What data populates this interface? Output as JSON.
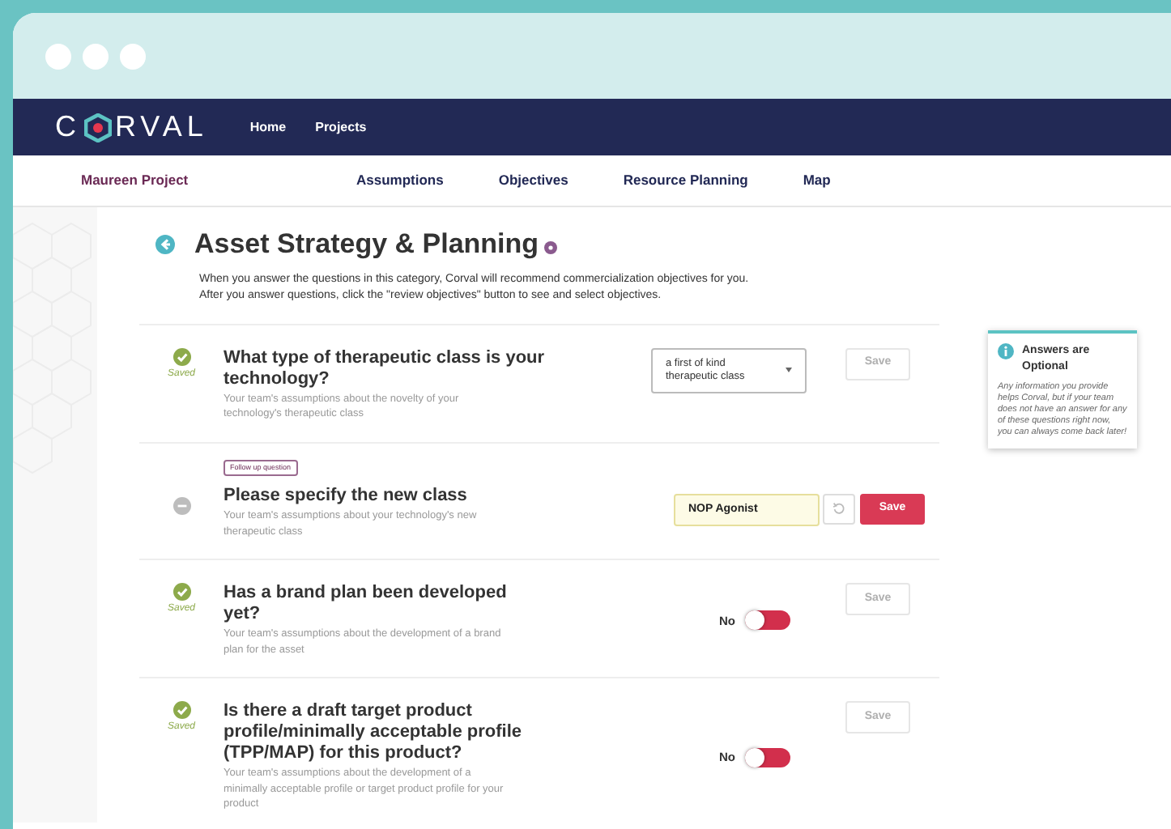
{
  "brand": {
    "first": "C",
    "rest": "RVAL"
  },
  "nav": [
    {
      "label": "Home"
    },
    {
      "label": "Projects"
    }
  ],
  "project": "Maureen Project",
  "tabs": [
    {
      "label": "Assumptions",
      "selected": false
    },
    {
      "label": "Objectives",
      "selected": false
    },
    {
      "label": "Resource Planning",
      "selected": false
    },
    {
      "label": "Map",
      "selected": false
    }
  ],
  "title": "Asset Strategy & Planning",
  "intro": [
    "When you answer the questions in this category, Corval will recommend commercialization objectives for you.",
    "After you answer questions, click the \"review objectives\" button to see and select objectives."
  ],
  "questions": [
    {
      "saved": true,
      "status_label": "Saved",
      "title": "What type of therapeutic class is your technology?",
      "description": "Your team's assumptions about the novelty of your technology's therapeutic class",
      "kind": "select",
      "value": "a first of kind therapeutic class",
      "save": "Save",
      "save_enabled": false
    },
    {
      "saved": false,
      "badge": "Follow up question",
      "title": "Please specify the new class",
      "description": "Your team's assumptions about your technology's new therapeutic class",
      "kind": "text",
      "value": "NOP Agonist",
      "reset": true,
      "save": "Save",
      "save_enabled": true
    },
    {
      "saved": true,
      "status_label": "Saved",
      "title": "Has a brand plan been developed yet?",
      "description": "Your team's assumptions about the development of a brand plan for the asset",
      "kind": "toggle",
      "value": "No",
      "on": false,
      "save": "Save",
      "save_enabled": false
    },
    {
      "saved": true,
      "status_label": "Saved",
      "title": "Is there a draft target product profile/minimally acceptable profile (TPP/MAP) for this product?",
      "description": "Your team's assumptions about the development of a minimally acceptable profile or target product profile for your product",
      "kind": "toggle",
      "value": "No",
      "on": false,
      "save": "Save",
      "save_enabled": false
    }
  ],
  "info": {
    "title": "Answers are Optional",
    "text": "Any information you provide helps Corval, but if your team does not have an answer for any of these questions right now, you can always come back later!"
  }
}
